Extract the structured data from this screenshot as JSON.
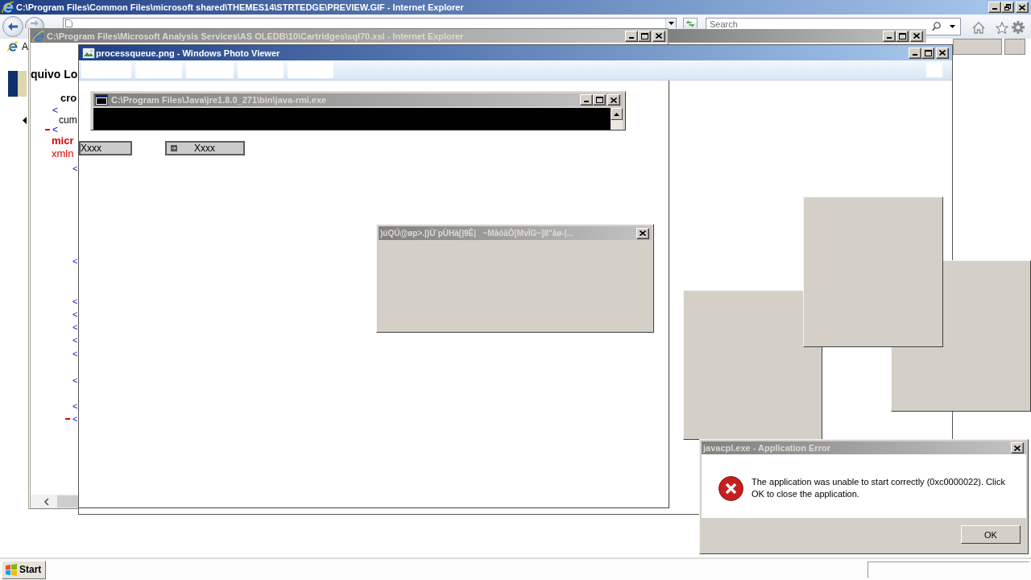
{
  "browser": {
    "title": "C:\\Program Files\\Common Files\\microsoft shared\\THEMES14\\STRTEDGE\\PREVIEW.GIF - Internet Explorer",
    "active": true,
    "search": {
      "placeholder": "Search"
    },
    "favorite": "A"
  },
  "untitled_window": {
    "active": false
  },
  "xsl_window": {
    "title": "C:\\Program Files\\Microsoft Analysis Services\\AS OLEDB\\10\\Cartridges\\sql70.xsl - Internet Explorer",
    "active": false,
    "heading": "quivo Lo",
    "subheading": "cro",
    "tree": [
      {
        "kind": "leaf",
        "text": "<"
      },
      {
        "kind": "text",
        "text": "cum"
      },
      {
        "kind": "branch",
        "text": "<",
        "expanded": true,
        "attributes": [
          {
            "kind": "name",
            "text": "micr"
          },
          {
            "kind": "attribute",
            "text": "xmln"
          }
        ],
        "children": [
          {
            "kind": "leaf",
            "text": "<"
          },
          {
            "kind": "leaf",
            "text": "<"
          },
          {
            "kind": "leaf",
            "text": "<"
          },
          {
            "kind": "leaf",
            "text": "<"
          },
          {
            "kind": "leaf",
            "text": "<"
          },
          {
            "kind": "leaf",
            "text": "<"
          },
          {
            "kind": "leaf",
            "text": "<"
          },
          {
            "kind": "leaf",
            "text": "<"
          },
          {
            "kind": "leaf",
            "text": "<"
          },
          {
            "kind": "branch",
            "text": "<",
            "expanded": true
          }
        ]
      }
    ]
  },
  "photo_viewer": {
    "title": "processqueue.png - Windows Photo Viewer",
    "active": true
  },
  "console": {
    "title": "C:\\Program Files\\Java\\jre1.8.0_271\\bin\\java-rmi.exe",
    "active": false
  },
  "floating_buttons": [
    {
      "label": "Xxxx",
      "kind": "text"
    },
    {
      "label": "Xxxx",
      "kind": "icon"
    }
  ],
  "garbled_dialog": {
    "title": ")úQÚ@øp>.|)Ù¨pÙHà[|9Ê|   ~MåóãÔ[MvÏG~]8\"åø-|...",
    "active": false
  },
  "error_dialog": {
    "title": "javacpl.exe - Application Error",
    "active": false,
    "message": "The application was unable to start correctly (0xc0000022). Click OK to close the application.",
    "button": "OK"
  },
  "taskbar": {
    "start": "Start"
  }
}
